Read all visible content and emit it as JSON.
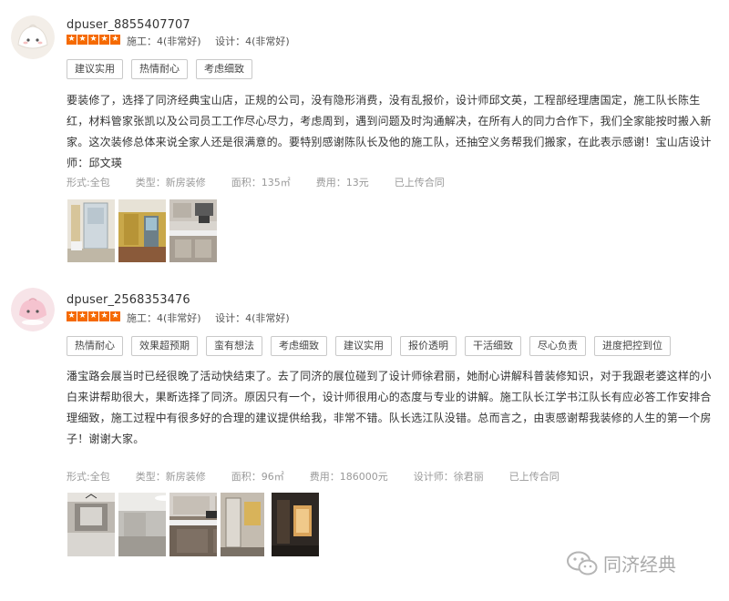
{
  "reviews": [
    {
      "username": "dpuser_8855407707",
      "rating": 5,
      "score_construction": "施工：4(非常好)",
      "score_design": "设计：4(非常好)",
      "tags": [
        "建议实用",
        "热情耐心",
        "考虑细致"
      ],
      "content": "要装修了，选择了同济经典宝山店，正规的公司，没有隐形消费，没有乱报价，设计师邱文英，工程部经理唐国定，施工队长陈生红，材料管家张凯以及公司员工工作尽心尽力，考虑周到，遇到问题及时沟通解决，在所有人的同力合作下，我们全家能按时搬入新家。这次装修总体来说全家人还是很满意的。要特别感谢陈队长及他的施工队，还抽空义务帮我们搬家，在此表示感谢！宝山店设计师：邱文瑛",
      "meta": [
        "形式:全包",
        "类型：新房装修",
        "面积：135㎡",
        "费用：13元",
        "已上传合同"
      ],
      "photos": [
        "photo-bathroom-door",
        "photo-yellow-wall",
        "photo-kitchen-cabinets"
      ]
    },
    {
      "username": "dpuser_2568353476",
      "rating": 5,
      "score_construction": "施工：4(非常好)",
      "score_design": "设计：4(非常好)",
      "tags": [
        "热情耐心",
        "效果超预期",
        "蛮有想法",
        "考虑细致",
        "建议实用",
        "报价透明",
        "干活细致",
        "尽心负责",
        "进度把控到位"
      ],
      "content": "潘宝路会展当时已经很晚了活动快结束了。去了同济的展位碰到了设计师徐君丽，她耐心讲解科普装修知识，对于我跟老婆这样的小白来讲帮助很大，果断选择了同济。原因只有一个，设计师很用心的态度与专业的讲解。施工队长江学书江队长有应必答工作安排合理细致，施工过程中有很多好的合理的建议提供给我，非常不错。队长选江队没错。总而言之，由衷感谢帮我装修的人生的第一个房子！谢谢大家。",
      "meta": [
        "形式:全包",
        "类型：新房装修",
        "面积：96㎡",
        "费用：186000元",
        "设计师：徐君丽",
        "已上传合同"
      ],
      "photos": [
        "photo-living-room",
        "photo-ceiling-light",
        "photo-kitchen-grey",
        "photo-bathroom-shower",
        "photo-dark-room"
      ]
    }
  ],
  "watermark": {
    "text": "同济经典",
    "icon": "wechat-icon"
  },
  "colors": {
    "star": "#f56a00",
    "tag_border": "#c9c9c9",
    "meta_text": "#999999",
    "avatar1": "#f3eee8",
    "avatar2": "#f5d7de"
  }
}
